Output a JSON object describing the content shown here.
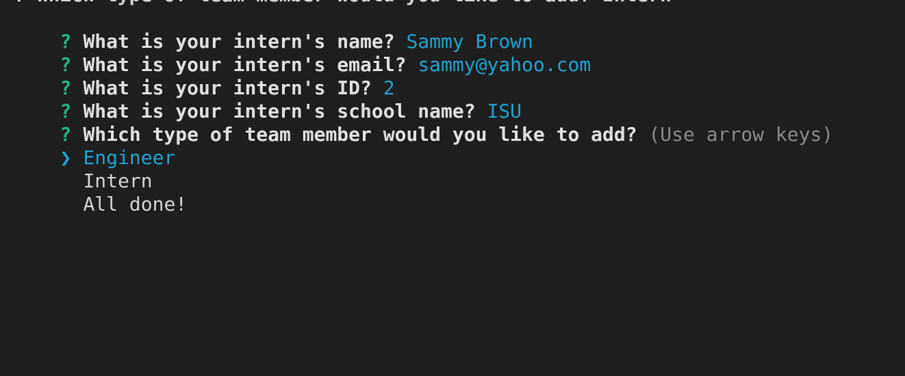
{
  "terminal": {
    "partial_line": "? Which type of team member would you like to add? Intern",
    "questions": [
      {
        "mark": "?",
        "prompt": "What is your intern's name?",
        "answer": "Sammy Brown"
      },
      {
        "mark": "?",
        "prompt": "What is your intern's email?",
        "answer": "sammy@yahoo.com"
      },
      {
        "mark": "?",
        "prompt": "What is your intern's ID?",
        "answer": "2"
      },
      {
        "mark": "?",
        "prompt": "What is your intern's school name?",
        "answer": "ISU"
      }
    ],
    "active_question": {
      "mark": "?",
      "prompt": "Which type of team member would you like to add?",
      "hint": "(Use arrow keys)"
    },
    "pointer": "❯",
    "choices": [
      {
        "label": "Engineer",
        "selected": true
      },
      {
        "label": "Intern",
        "selected": false
      },
      {
        "label": "All done!",
        "selected": false
      }
    ]
  },
  "colors": {
    "background": "#1e1e1e",
    "question_mark": "#23b58a",
    "answer": "#1fa3d1",
    "hint": "#8a8a8a"
  }
}
